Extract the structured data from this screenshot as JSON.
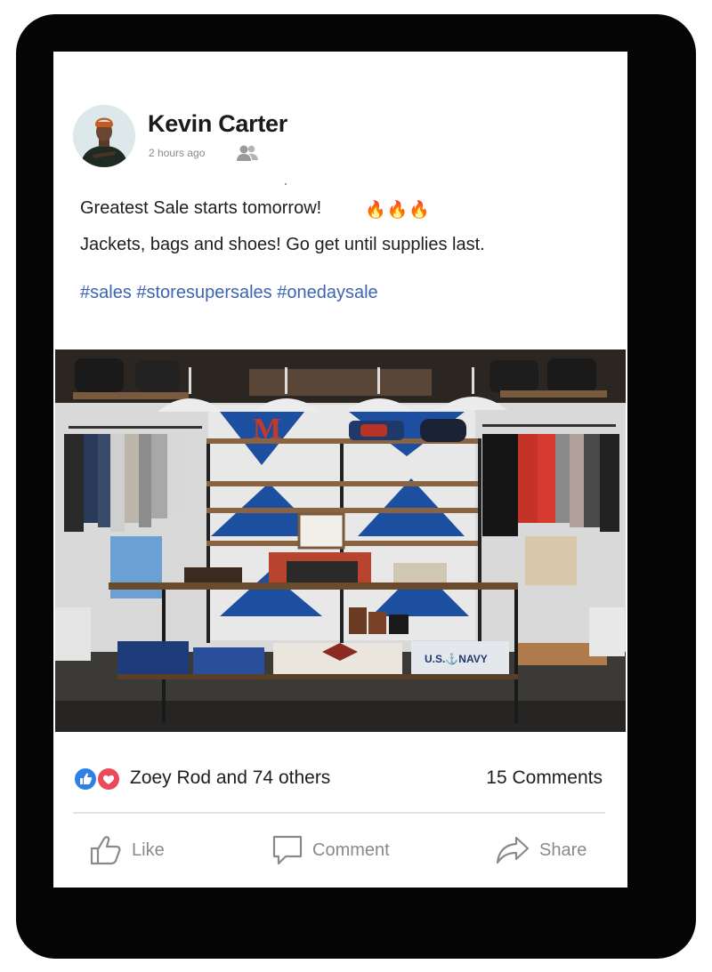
{
  "post": {
    "author": "Kevin Carter",
    "time": "2 hours ago",
    "line1": "Greatest Sale starts tomorrow!",
    "emoji": "🔥🔥🔥",
    "line2": "Jackets, bags and shoes! Go get until supplies last.",
    "hashtags": "#sales #storesupersales #onedaysale"
  },
  "photo_signs": {
    "letter": "M",
    "fold_text": "U.S.⚓NAVY"
  },
  "stats": {
    "reactions_text": "Zoey Rod and 74 others",
    "comments_text": "15 Comments"
  },
  "actions": {
    "like": "Like",
    "comment": "Comment",
    "share": "Share"
  },
  "icons": {
    "audience": "friends-icon",
    "like_reaction": "thumbs-up-reaction-icon",
    "love_reaction": "heart-reaction-icon"
  },
  "colors": {
    "hashtag": "#3d64b0",
    "like_reaction": "#2f7fe8",
    "love_reaction": "#ec4a5b",
    "muted": "#8a8a8a"
  }
}
